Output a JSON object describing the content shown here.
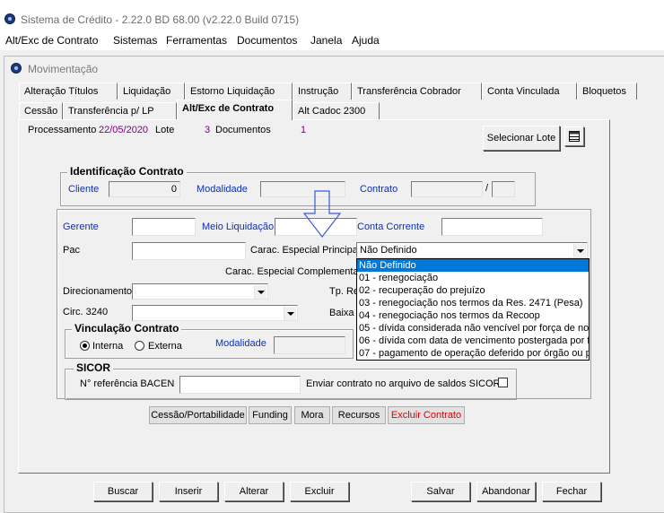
{
  "app": {
    "title": "Sistema de Crédito - 2.22.0 BD 68.00 (v2.22.0 Build 0715)"
  },
  "menu": [
    "Alt/Exc de Contrato",
    "Sistemas",
    "Ferramentas",
    "Documentos",
    "Janela",
    "Ajuda"
  ],
  "window": {
    "title": "Movimentação"
  },
  "tabs_row1": [
    "Alteração Títulos",
    "Liquidação",
    "Estorno Liquidação",
    "Instrução",
    "Transferência Cobrador",
    "Conta Vinculada",
    "Bloquetos"
  ],
  "tabs_row2": [
    "Cessão",
    "Transferência p/ LP",
    "Alt/Exc de Contrato",
    "Alt Cadoc 2300"
  ],
  "info": {
    "processamento_label": "Processamento",
    "processamento_value": "22/05/2020",
    "lote_label": "Lote",
    "lote_value": "3",
    "documentos_label": "Documentos",
    "documentos_value": "1",
    "selecionar_lote": "Selecionar Lote"
  },
  "identificacao": {
    "title": "Identificação Contrato",
    "cliente_label": "Cliente",
    "cliente_value": "0",
    "modalidade_label": "Modalidade",
    "contrato_label": "Contrato",
    "slash": "/"
  },
  "form": {
    "gerente_label": "Gerente",
    "meio_liquidacao_label": "Meio Liquidação",
    "conta_corrente_label": "Conta Corrente",
    "pac_label": "Pac",
    "carac_principal_label": "Carac. Especial Principal",
    "carac_principal_value": "Não Definido",
    "carac_complementar_label": "Carac. Especial Complementar",
    "direcionamento_label": "Direcionamento",
    "tp_label": "Tp. Re",
    "circ_label": "Circ. 3240",
    "baixa_label": "Baixa"
  },
  "dropdown_options": [
    "Não Definido",
    "01 - renegociação",
    "02 - recuperação do prejuízo",
    "03 - renegociação nos termos da Res. 2471 (Pesa)",
    "04 - renegociação nos termos da Recoop",
    "05 - dívida considerada não vencível por força de nor",
    "06 - dívida com data de vencimento postergada por fo",
    "07 - pagamento de operação deferido por órgão ou pre"
  ],
  "vinculacao": {
    "title": "Vinculação Contrato",
    "interna": "Interna",
    "externa": "Externa",
    "modalidade_label": "Modalidade"
  },
  "sicor": {
    "title": "SICOR",
    "ref_label": "N° referência BACEN",
    "enviar_label": "Enviar contrato no arquivo de saldos SICOR"
  },
  "action_buttons": [
    "Cessão/Portabilidade",
    "Funding",
    "Mora",
    "Recursos",
    "Excluir Contrato"
  ],
  "bottom_buttons": [
    "Buscar",
    "Inserir",
    "Alterar",
    "Excluir",
    "Salvar",
    "Abandonar",
    "Fechar"
  ],
  "colors": {
    "label_blue": "#0b2fbd",
    "value_purple": "#800080",
    "delete_red": "#e00000",
    "selection_blue": "#0078d7"
  }
}
